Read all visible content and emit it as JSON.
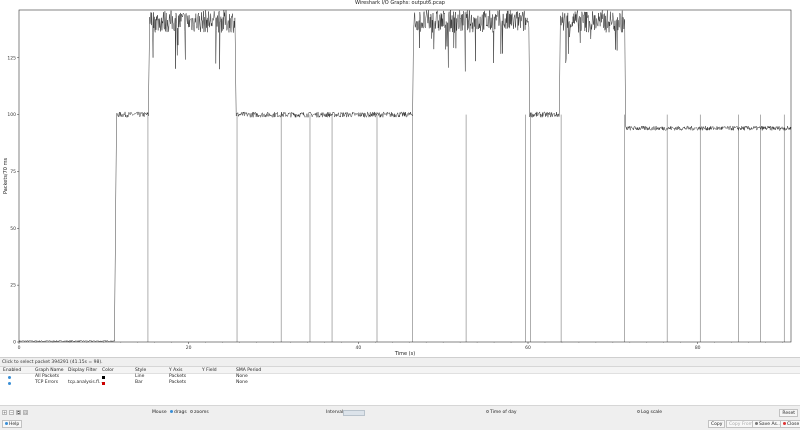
{
  "window": {
    "title": "Wireshark I/O Graphs: output6.pcap"
  },
  "chart_data": {
    "type": "line",
    "xlabel": "Time (s)",
    "ylabel": "Packets/70 ms",
    "xlim": [
      0,
      91
    ],
    "ylim": [
      0,
      146
    ],
    "x_ticks": [
      0,
      20,
      40,
      60,
      80
    ],
    "y_ticks": [
      0,
      25,
      50,
      75,
      100,
      125
    ],
    "series": [
      {
        "name": "All Packets",
        "color": "#000000",
        "segments": [
          {
            "start": 0.0,
            "end": 11.3,
            "level": 0.4,
            "noise": 0.3
          },
          {
            "start": 11.5,
            "end": 15.3,
            "level": 100,
            "noise": 1.2
          },
          {
            "start": 15.4,
            "end": 25.5,
            "level": 141,
            "noise": 5
          },
          {
            "start": 25.6,
            "end": 46.4,
            "level": 100,
            "noise": 1.2
          },
          {
            "start": 46.5,
            "end": 60.1,
            "level": 141,
            "noise": 5
          },
          {
            "start": 60.2,
            "end": 63.7,
            "level": 100,
            "noise": 1.2
          },
          {
            "start": 63.8,
            "end": 71.4,
            "level": 141,
            "noise": 5
          },
          {
            "start": 71.5,
            "end": 91.0,
            "level": 94,
            "noise": 1
          }
        ],
        "dips": [
          15.2,
          25.7,
          30.9,
          34.3,
          36.9,
          42.2,
          46.4,
          52.7,
          59.7,
          60.3,
          63.9,
          71.4,
          76.4,
          80.3,
          84.8,
          87.4,
          90.2
        ]
      }
    ]
  },
  "status": {
    "text": "Click to select packet 394291 (41.15s = 98)."
  },
  "graph_table": {
    "headers": [
      "Enabled",
      "Graph Name",
      "Display Filter",
      "Color",
      "Style",
      "Y Axis",
      "Y Field",
      "SMA Period"
    ],
    "rows": [
      {
        "name": "All Packets",
        "filter": "",
        "color": "#000000",
        "style": "Line",
        "y_axis": "Packets",
        "y_field": "",
        "sma": "None"
      },
      {
        "name": "TCP Errors",
        "filter": "tcp.analysis.fl...",
        "color": "#cc0000",
        "style": "Bar",
        "y_axis": "Packets",
        "y_field": "",
        "sma": "None"
      }
    ]
  },
  "controls": {
    "table_buttons": [
      "+",
      "−",
      "⧉",
      "⊡"
    ],
    "mouse_label": "Mouse",
    "drags_label": "drags",
    "zooms_label": "zooms",
    "interval_label": "Interval",
    "interval_value": "",
    "time_of_day_label": "Time of day",
    "log_scale_label": "Log scale",
    "reset_label": "Reset"
  },
  "buttons": {
    "help": "Help",
    "copy": "Copy",
    "copy_from": "Copy From",
    "save_as": "Save As...",
    "close": "Close"
  }
}
